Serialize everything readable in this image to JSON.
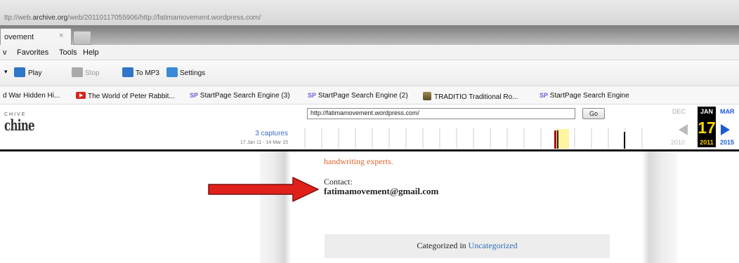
{
  "browser": {
    "address": {
      "prefix": "ttp://web.",
      "domain": "archive.org",
      "path": "/web/20110117055906/http://fatimamovement.wordpress.com/"
    },
    "tab": {
      "label": "ovement",
      "close": "×"
    },
    "menu": [
      "v",
      "Favorites",
      "Tools",
      "Help"
    ],
    "toolbar": {
      "play": "Play",
      "stop": "Stop",
      "tomp3": "To MP3",
      "settings": "Settings"
    },
    "favorites": [
      "d War Hidden Hi...",
      "The World of Peter Rabbit...",
      "StartPage Search Engine (3)",
      "StartPage Search Engine (2)",
      "TRADITIO Traditional Ro...",
      "StartPage Search Engine"
    ],
    "sp_badge": "SP"
  },
  "wayback": {
    "logo_top": "CHIVE",
    "logo": "chine",
    "url_value": "http://fatimamovement.wordpress.com/",
    "go": "Go",
    "captures": "3 captures",
    "capture_range": "17 Jan 11 - 14 Mar 15",
    "months": {
      "prev": "DEC",
      "current": "JAN",
      "next": "MAR"
    },
    "day": "17",
    "years": {
      "prev": "2010",
      "current": "2011",
      "next": "2015"
    },
    "colors": {
      "highlight": "#ffd500",
      "link": "#1c5bd8"
    }
  },
  "post": {
    "partial_text": "handwriting experts.",
    "contact_label": "Contact:",
    "contact_email": "fatimamovement@gmail.com",
    "category_prefix": "Categorized in",
    "category_link": "Uncategorized",
    "colors": {
      "orange_text": "#e0602c",
      "arrow": "#e0201a"
    }
  }
}
